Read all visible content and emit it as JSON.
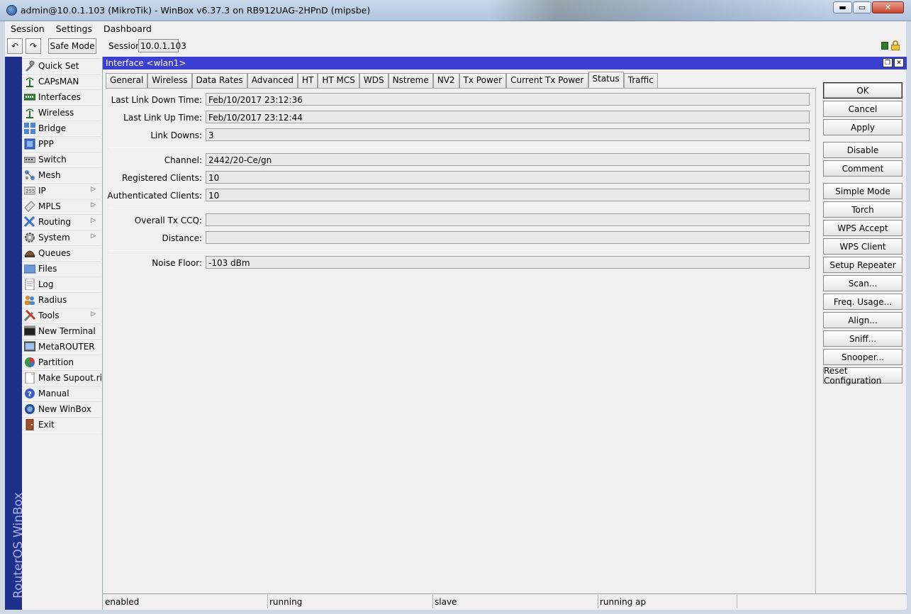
{
  "window": {
    "title": "admin@10.0.1.103 (MikroTik) - WinBox v6.37.3 on RB912UAG-2HPnD (mipsbe)",
    "min_label": "▬",
    "max_label": "▭",
    "close_label": "✕"
  },
  "menubar": {
    "items": [
      "Session",
      "Settings",
      "Dashboard"
    ]
  },
  "toolbar": {
    "undo_label": "↶",
    "redo_label": "↷",
    "safe_mode_label": "Safe Mode",
    "session_label": "Session:",
    "session_value": "10.0.1.103"
  },
  "brand": {
    "text": "RouterOS WinBox"
  },
  "sidebar": {
    "items": [
      {
        "label": "Quick Set",
        "icon": "quick-set-icon"
      },
      {
        "label": "CAPsMAN",
        "icon": "capsman-icon"
      },
      {
        "label": "Interfaces",
        "icon": "interfaces-icon"
      },
      {
        "label": "Wireless",
        "icon": "wireless-icon"
      },
      {
        "label": "Bridge",
        "icon": "bridge-icon"
      },
      {
        "label": "PPP",
        "icon": "ppp-icon"
      },
      {
        "label": "Switch",
        "icon": "switch-icon"
      },
      {
        "label": "Mesh",
        "icon": "mesh-icon"
      },
      {
        "label": "IP",
        "icon": "ip-icon",
        "submenu": true
      },
      {
        "label": "MPLS",
        "icon": "mpls-icon",
        "submenu": true
      },
      {
        "label": "Routing",
        "icon": "routing-icon",
        "submenu": true
      },
      {
        "label": "System",
        "icon": "system-icon",
        "submenu": true
      },
      {
        "label": "Queues",
        "icon": "queues-icon"
      },
      {
        "label": "Files",
        "icon": "files-icon"
      },
      {
        "label": "Log",
        "icon": "log-icon"
      },
      {
        "label": "Radius",
        "icon": "radius-icon"
      },
      {
        "label": "Tools",
        "icon": "tools-icon",
        "submenu": true
      },
      {
        "label": "New Terminal",
        "icon": "terminal-icon"
      },
      {
        "label": "MetaROUTER",
        "icon": "metarouter-icon"
      },
      {
        "label": "Partition",
        "icon": "partition-icon"
      },
      {
        "label": "Make Supout.rif",
        "icon": "supout-icon"
      },
      {
        "label": "Manual",
        "icon": "manual-icon"
      },
      {
        "label": "New WinBox",
        "icon": "winbox-icon"
      },
      {
        "label": "Exit",
        "icon": "exit-icon"
      }
    ]
  },
  "dialog": {
    "title": "Interface <wlan1>",
    "tabs": [
      "General",
      "Wireless",
      "Data Rates",
      "Advanced",
      "HT",
      "HT MCS",
      "WDS",
      "Nstreme",
      "NV2",
      "Tx Power",
      "Current Tx Power",
      "Status",
      "Traffic"
    ],
    "active_tab": "Status",
    "fields": [
      {
        "label": "Last Link Down Time:",
        "value": "Feb/10/2017 23:12:36"
      },
      {
        "label": "Last Link Up Time:",
        "value": "Feb/10/2017 23:12:44"
      },
      {
        "label": "Link Downs:",
        "value": "3"
      },
      {
        "label": "Channel:",
        "value": "2442/20-Ce/gn"
      },
      {
        "label": "Registered Clients:",
        "value": "10"
      },
      {
        "label": "Authenticated Clients:",
        "value": "10"
      },
      {
        "label": "Overall Tx CCQ:",
        "value": ""
      },
      {
        "label": "Distance:",
        "value": ""
      },
      {
        "label": "Noise Floor:",
        "value": "-103 dBm"
      }
    ],
    "buttons": [
      "OK",
      "Cancel",
      "Apply",
      "Disable",
      "Comment",
      "Simple Mode",
      "Torch",
      "WPS Accept",
      "WPS Client",
      "Setup Repeater",
      "Scan...",
      "Freq. Usage...",
      "Align...",
      "Sniff...",
      "Snooper...",
      "Reset Configuration"
    ],
    "status": [
      "enabled",
      "running",
      "slave",
      "running ap",
      ""
    ]
  }
}
